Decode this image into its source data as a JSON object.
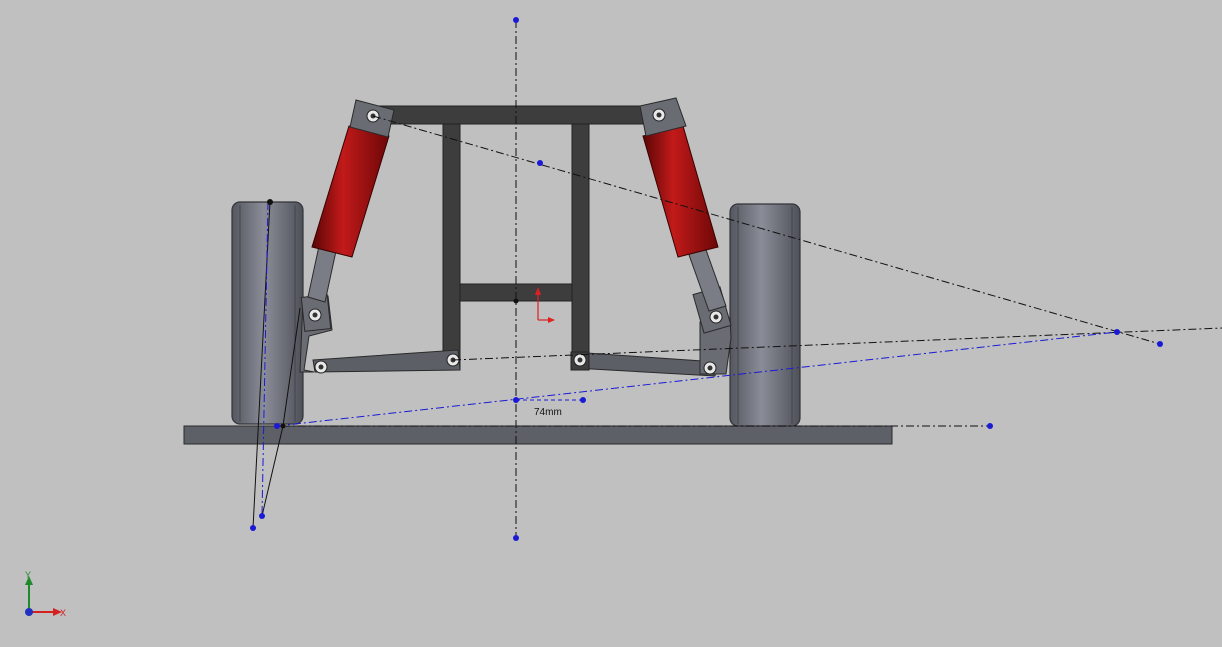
{
  "viewport": {
    "background": "#c0c0c0"
  },
  "dimension": {
    "value_label": "74mm"
  },
  "triad": {
    "x_label": "X",
    "y_label": "Y",
    "x_color": "#d42020",
    "y_color": "#1e8a2e",
    "z_color": "#2030c0"
  },
  "colors": {
    "frame": "#3d3d3d",
    "wheel": "#6b6e7a",
    "shock_body": "#8a0a0a",
    "sketch_black": "#111111",
    "sketch_blue": "#1a1ad6",
    "ground_plate": "#5e6068",
    "origin_marker": "#e02020"
  },
  "icons": {
    "origin": "origin-icon",
    "triad": "coordinate-triad-icon"
  }
}
